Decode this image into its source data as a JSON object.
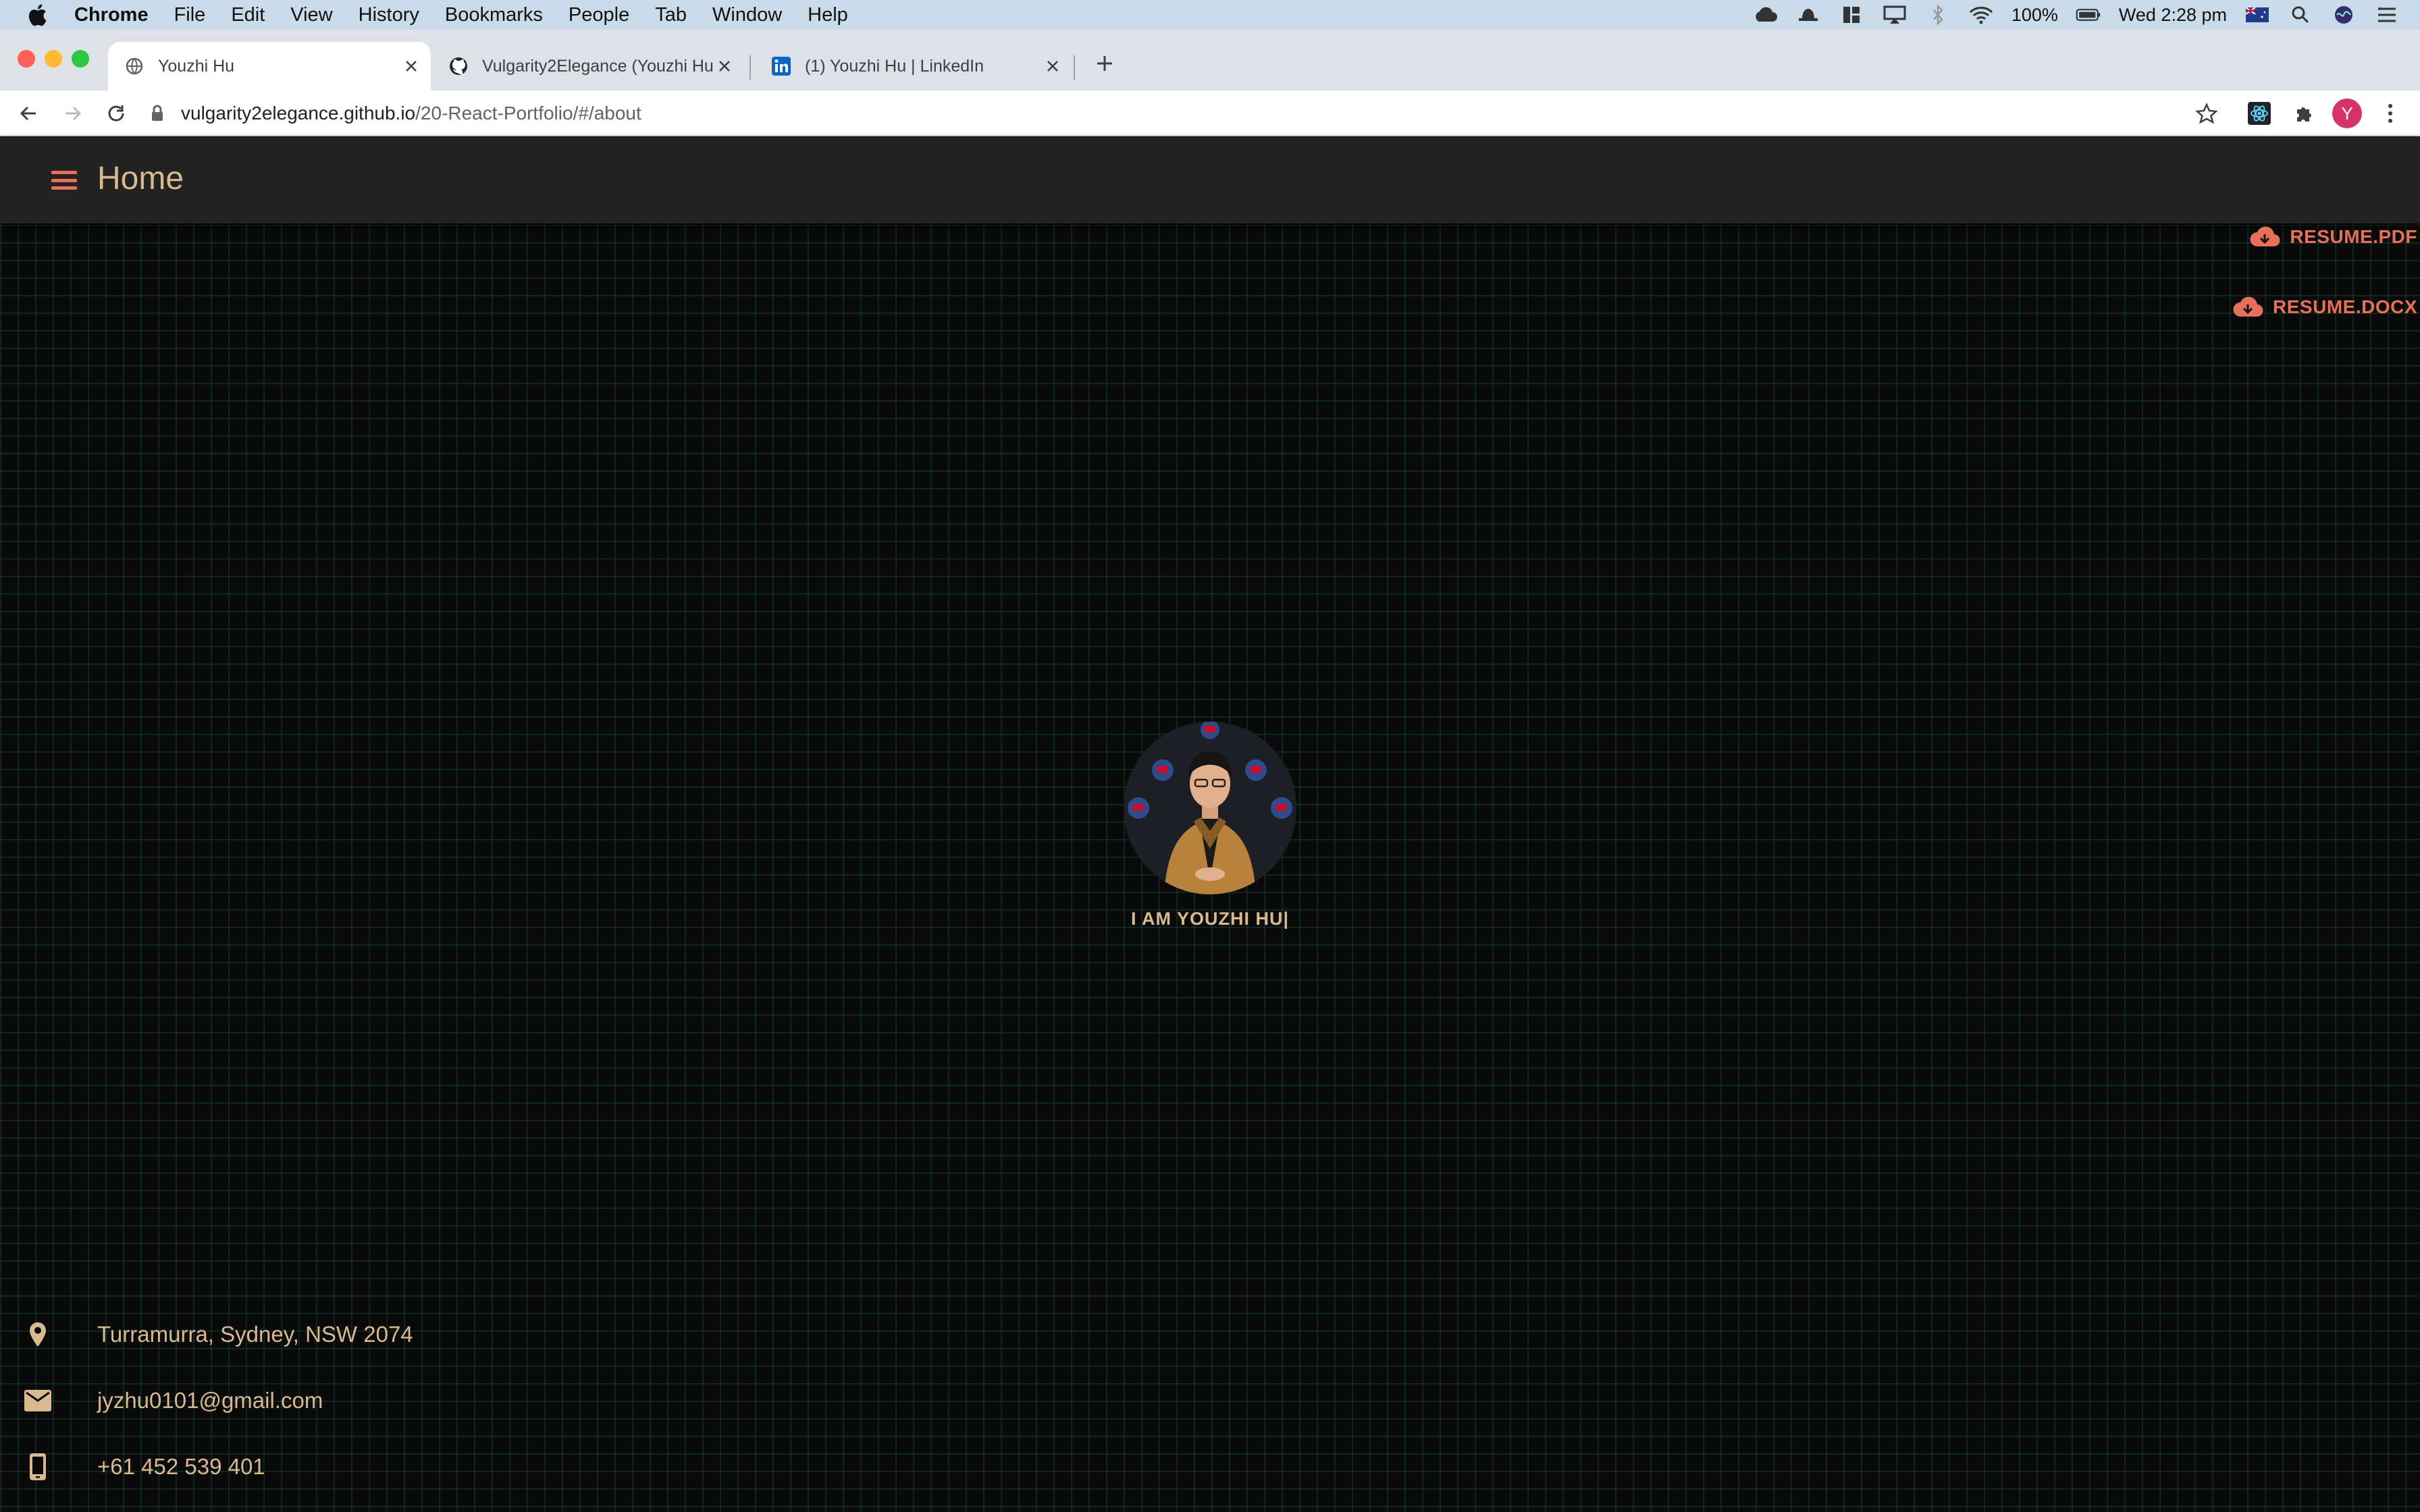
{
  "menubar": {
    "app_name": "Chrome",
    "items": [
      "File",
      "Edit",
      "View",
      "History",
      "Bookmarks",
      "People",
      "Tab",
      "Window",
      "Help"
    ],
    "battery": "100%",
    "clock": "Wed 2:28 pm"
  },
  "tabs": [
    {
      "title": "Youzhi Hu",
      "icon": "globe-icon",
      "active": true
    },
    {
      "title": "Vulgarity2Elegance (Youzhi Hu",
      "icon": "github-icon",
      "active": false
    },
    {
      "title": "(1) Youzhi Hu | LinkedIn",
      "icon": "linkedin-icon",
      "active": false
    }
  ],
  "address_bar": {
    "host": "vulgarity2elegance.github.io",
    "path": "/20-React-Portfolio/#/about"
  },
  "profile_initial": "Y",
  "colors": {
    "accent": "#e8705a",
    "text_gold": "#d9b990",
    "appbar": "#222222",
    "grid": "#145a46"
  },
  "appbar": {
    "title": "Home"
  },
  "resume": {
    "pdf_label": "RESUME.PDF",
    "docx_label": "RESUME.DOCX"
  },
  "intro": {
    "text": "I AM YOUZHI HU|"
  },
  "contacts": {
    "address": "Turramurra, Sydney, NSW 2074",
    "email": "jyzhu0101@gmail.com",
    "phone": "+61 452 539 401"
  }
}
